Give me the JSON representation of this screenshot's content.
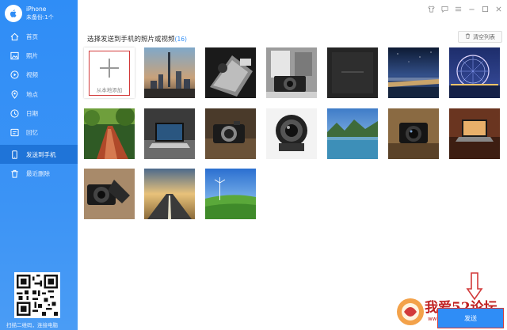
{
  "device": {
    "name": "iPhone",
    "status": "未备份:1个"
  },
  "sidebar": {
    "items": [
      {
        "label": "首页",
        "icon": "home-icon"
      },
      {
        "label": "照片",
        "icon": "photo-icon"
      },
      {
        "label": "视频",
        "icon": "video-icon"
      },
      {
        "label": "地点",
        "icon": "location-icon"
      },
      {
        "label": "日期",
        "icon": "clock-icon"
      },
      {
        "label": "回忆",
        "icon": "memory-icon"
      },
      {
        "label": "发送到手机",
        "icon": "phone-icon",
        "active": true
      },
      {
        "label": "最近删除",
        "icon": "trash-icon"
      }
    ],
    "qr_caption": "扫描二维码，连接电脑"
  },
  "window": {
    "controls": [
      "shirt-icon",
      "chat-icon",
      "menu-icon",
      "minimize-icon",
      "maximize-icon",
      "close-icon"
    ]
  },
  "main": {
    "title": "选择发送到手机的照片或视频",
    "count": "(16)",
    "clear_label": "清空列表",
    "add_label": "从本地添加",
    "send_label": "发送"
  },
  "watermark": {
    "text": "我爱52论坛",
    "url": "www.tao.wip52.cn"
  },
  "colors": {
    "accent": "#2f8df6",
    "sidebar_active": "#1f74d8",
    "highlight": "#d23a3a"
  }
}
